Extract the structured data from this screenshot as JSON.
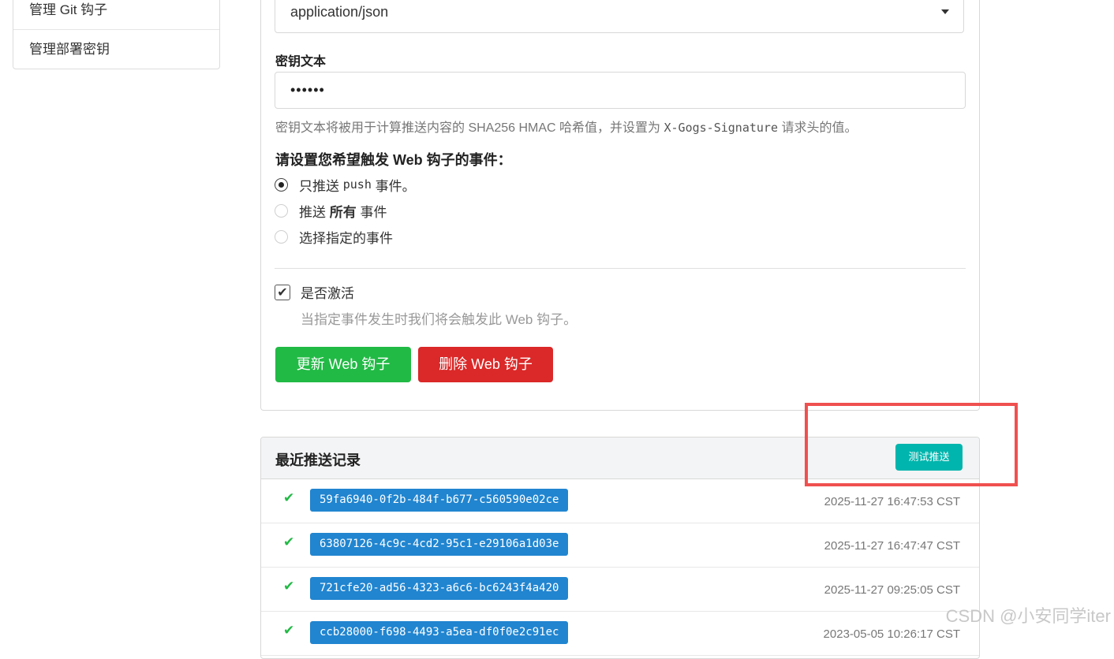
{
  "sidebar": {
    "items": [
      {
        "label": "管理 Git 钩子"
      },
      {
        "label": "管理部署密钥"
      }
    ]
  },
  "form": {
    "content_type_value": "application/json",
    "secret_label": "密钥文本",
    "secret_value": "••••••",
    "secret_help_prefix": "密钥文本将被用于计算推送内容的 SHA256 HMAC 哈希值，并设置为 ",
    "secret_help_code": "X-Gogs-Signature",
    "secret_help_suffix": " 请求头的值。",
    "events_title": "请设置您希望触发 Web 钩子的事件：",
    "event_options": [
      {
        "prefix": "只推送 ",
        "code": "push",
        "suffix": " 事件。",
        "checked": true
      },
      {
        "prefix": "推送 ",
        "bold": "所有",
        "suffix": " 事件",
        "checked": false
      },
      {
        "label": "选择指定的事件",
        "checked": false
      }
    ],
    "active_label": "是否激活",
    "active_checked": true,
    "active_help": "当指定事件发生时我们将会触发此 Web 钩子。",
    "update_button": "更新 Web 钩子",
    "delete_button": "删除 Web 钩子"
  },
  "history": {
    "title": "最近推送记录",
    "test_button": "测试推送",
    "deliveries": [
      {
        "status": "success",
        "id": "59fa6940-0f2b-484f-b677-c560590e02ce",
        "time": "2025-11-27 16:47:53 CST"
      },
      {
        "status": "success",
        "id": "63807126-4c9c-4cd2-95c1-e29106a1d03e",
        "time": "2025-11-27 16:47:47 CST"
      },
      {
        "status": "success",
        "id": "721cfe20-ad56-4323-a6c6-bc6243f4a420",
        "time": "2025-11-27 09:25:05 CST"
      },
      {
        "status": "success",
        "id": "ccb28000-f698-4493-a5ea-df0f0e2c91ec",
        "time": "2023-05-05 10:26:17 CST"
      }
    ]
  },
  "watermark": "CSDN @小安同学iter",
  "colors": {
    "green": "#21ba45",
    "red": "#db2828",
    "teal": "#00b5ad",
    "blue": "#2185d0",
    "annotation": "#f05050"
  }
}
